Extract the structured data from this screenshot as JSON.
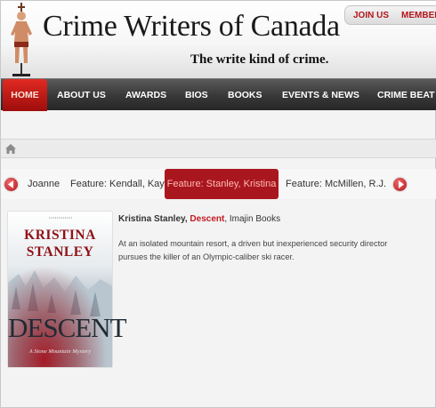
{
  "header": {
    "site_title": "Crime Writers of Canada",
    "tagline": "The write kind of crime.",
    "top_links": [
      "JOIN US",
      "MEMBER"
    ]
  },
  "nav": {
    "items": [
      "HOME",
      "ABOUT US",
      "AWARDS",
      "BIOS",
      "BOOKS",
      "EVENTS & NEWS",
      "CRIME BEAT"
    ],
    "active": "HOME"
  },
  "carousel": {
    "items": [
      "Joanne",
      "Feature: Kendall, Kay",
      "Feature: Stanley, Kristina",
      "Feature: McMillen, R.J."
    ],
    "active": "Feature: Stanley, Kristina"
  },
  "book": {
    "author": "Kristina Stanley",
    "separator": ",",
    "title": "Descent",
    "publisher": ", Imajin Books",
    "description": "At an isolated mountain resort, a driven but inexperienced security director pursues the killer of an Olympic-caliber ski racer.",
    "cover": {
      "author_line1": "KRISTINA",
      "author_line2": "STANLEY",
      "title": "DESCENT",
      "series": "A Stone Mountain Mystery"
    }
  },
  "colors": {
    "accent_red": "#b3151b",
    "nav_dark": "#3a3a3a",
    "active_tab": "#a9161e"
  }
}
